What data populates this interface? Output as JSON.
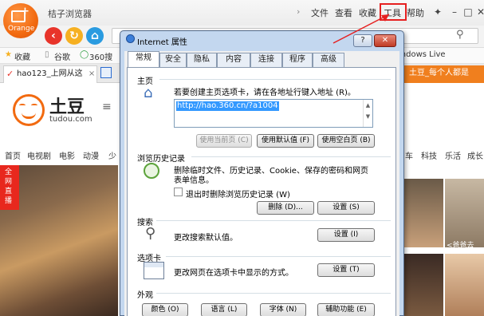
{
  "browser": {
    "logo_text": "Orange",
    "title": "桔子浏览器",
    "menu": [
      "文件",
      "查看",
      "收藏",
      "工具",
      "帮助"
    ],
    "window_buttons": [
      "✦",
      "–",
      "□",
      "✕"
    ],
    "bookmarks": [
      "收藏",
      "谷歌",
      "360搜"
    ],
    "bookmarks_right": "indows Live",
    "tabs": {
      "first": "hao123_上网从这",
      "right": "土豆_每个人都是"
    }
  },
  "page": {
    "brand": "土豆",
    "brand_sub": "tudou.com",
    "nav_left": [
      "首页",
      "电视剧",
      "电影",
      "动漫",
      "少"
    ],
    "nav_right": [
      "车",
      "科技",
      "乐活",
      "成长"
    ],
    "photo_label": "全网直播",
    "thumb_caption": "<爸爸去"
  },
  "dialog": {
    "title": "Internet 属性",
    "help": "?",
    "close": "✕",
    "tabs": [
      "常规",
      "安全",
      "隐私",
      "内容",
      "连接",
      "程序",
      "高级"
    ],
    "home": {
      "section": "主页",
      "desc": "若要创建主页选项卡，请在各地址行键入地址 (R)。",
      "url": "http://hao.360.cn/?a1004",
      "btn_current": "使用当前页 (C)",
      "btn_default": "使用默认值 (F)",
      "btn_blank": "使用空白页 (B)"
    },
    "history": {
      "section": "浏览历史记录",
      "desc1": "删除临时文件、历史记录、Cookie、保存的密码和网页",
      "desc2": "表单信息。",
      "checkbox": "退出时删除浏览历史记录 (W)",
      "btn_delete": "删除 (D)...",
      "btn_settings": "设置 (S)"
    },
    "search": {
      "section": "搜索",
      "desc": "更改搜索默认值。",
      "btn_settings": "设置 (I)"
    },
    "tabsect": {
      "section": "选项卡",
      "desc": "更改网页在选项卡中显示的方式。",
      "btn_settings": "设置 (T)"
    },
    "appearance": {
      "section": "外观",
      "buttons": [
        "颜色 (O)",
        "语言 (L)",
        "字体 (N)",
        "辅助功能 (E)"
      ]
    }
  },
  "colors": {
    "accent": "#f26a10",
    "annotation": "#e62020",
    "selection": "#3399ff"
  }
}
